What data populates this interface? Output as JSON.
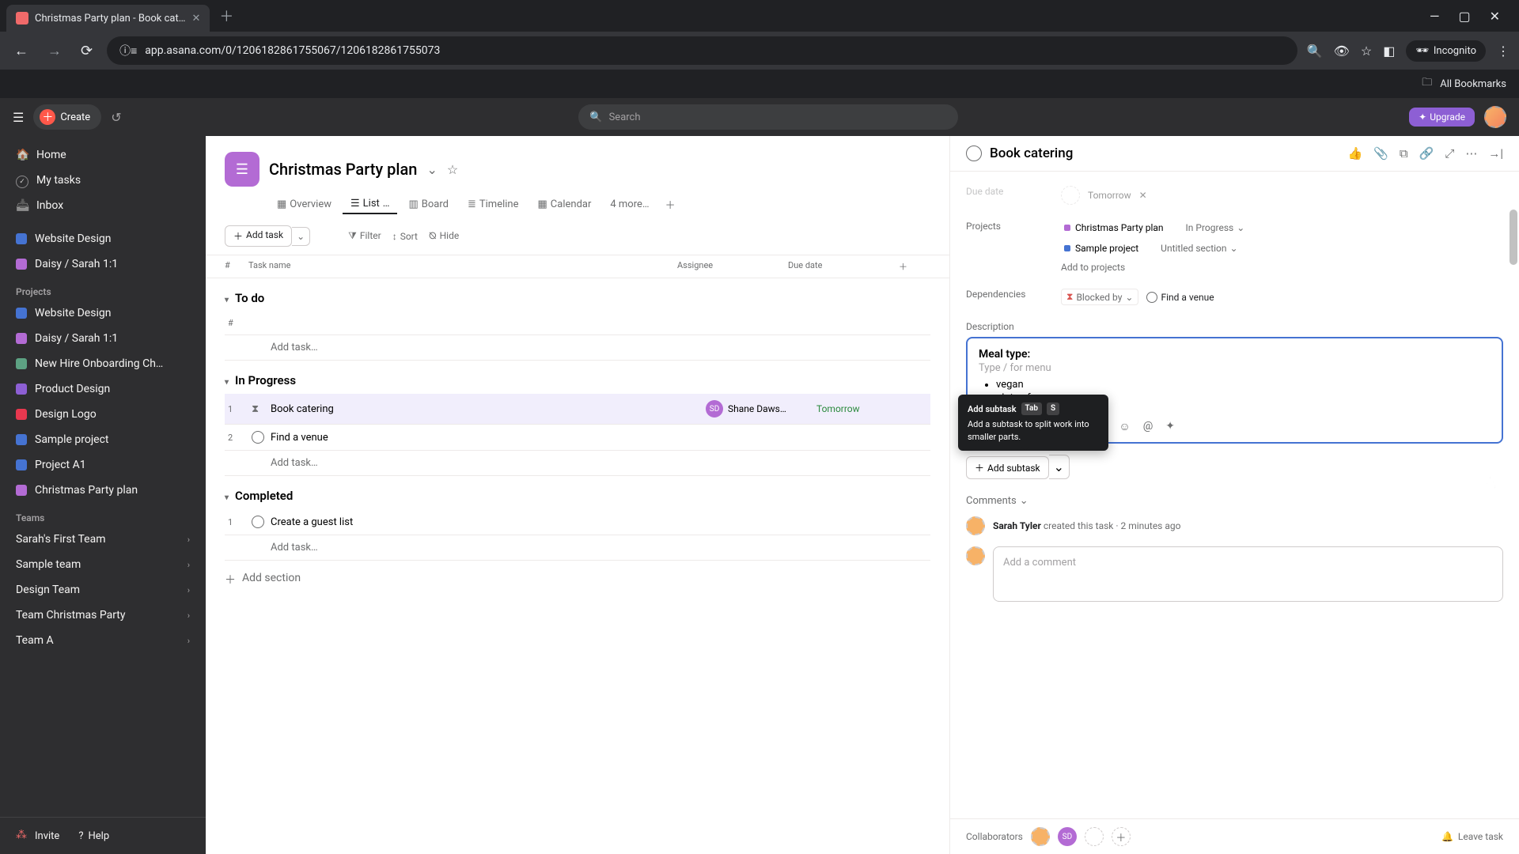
{
  "browser": {
    "tab_title": "Christmas Party plan - Book cat…",
    "url": "app.asana.com/0/1206182861755067/1206182861755073",
    "incognito": "Incognito",
    "all_bookmarks": "All Bookmarks"
  },
  "header": {
    "create": "Create",
    "search_placeholder": "Search",
    "upgrade": "Upgrade"
  },
  "sidebar": {
    "home": "Home",
    "my_tasks": "My tasks",
    "inbox": "Inbox",
    "starred": [
      {
        "label": "Website Design",
        "color": "#4573d2"
      },
      {
        "label": "Daisy / Sarah 1:1",
        "color": "#b36bd4"
      }
    ],
    "projects_header": "Projects",
    "projects": [
      {
        "label": "Website Design",
        "color": "#4573d2"
      },
      {
        "label": "Daisy / Sarah 1:1",
        "color": "#b36bd4"
      },
      {
        "label": "New Hire Onboarding Ch…",
        "color": "#5da283"
      },
      {
        "label": "Product Design",
        "color": "#8d5fd4"
      },
      {
        "label": "Design Logo",
        "color": "#e8384f"
      },
      {
        "label": "Sample project",
        "color": "#4573d2"
      },
      {
        "label": "Project A1",
        "color": "#4573d2"
      },
      {
        "label": "Christmas Party plan",
        "color": "#b36bd4"
      }
    ],
    "teams_header": "Teams",
    "teams": [
      "Sarah's First Team",
      "Sample team",
      "Design Team",
      "Team Christmas Party",
      "Team A"
    ],
    "invite": "Invite",
    "help": "Help"
  },
  "project": {
    "title": "Christmas Party plan",
    "tabs": {
      "overview": "Overview",
      "list": "List",
      "board": "Board",
      "timeline": "Timeline",
      "calendar": "Calendar",
      "more": "4 more…"
    },
    "add_task": "Add task",
    "filter": "Filter",
    "sort": "Sort",
    "hide": "Hide",
    "columns": {
      "num": "#",
      "name": "Task name",
      "assignee": "Assignee",
      "due": "Due date"
    }
  },
  "sections": {
    "todo": {
      "title": "To do",
      "add": "Add task…"
    },
    "in_progress": {
      "title": "In Progress",
      "rows": [
        {
          "num": "1",
          "name": "Book catering",
          "assignee": "Shane Daws…",
          "assignee_initials": "SD",
          "due": "Tomorrow"
        },
        {
          "num": "2",
          "name": "Find a venue",
          "assignee": "",
          "due": ""
        }
      ],
      "add": "Add task…"
    },
    "completed": {
      "title": "Completed",
      "rows": [
        {
          "num": "1",
          "name": "Create a guest list"
        }
      ],
      "add": "Add task…"
    },
    "add_section": "Add section"
  },
  "detail": {
    "title": "Book catering",
    "fields": {
      "due_date_label": "Due date",
      "due_date_value": "Tomorrow",
      "projects_label": "Projects",
      "project1": "Christmas Party plan",
      "project1_status": "In Progress",
      "project2": "Sample project",
      "project2_status": "Untitled section",
      "add_to_projects": "Add to projects",
      "dependencies_label": "Dependencies",
      "blocked_by": "Blocked by",
      "dep_task": "Find a venue",
      "description_label": "Description"
    },
    "description": {
      "title": "Meal type:",
      "placeholder": "Type / for menu",
      "items": [
        "vegan",
        "gluten free"
      ]
    },
    "add_subtask": "Add subtask",
    "tooltip": {
      "title": "Add subtask",
      "key1": "Tab",
      "key2": "S",
      "body": "Add a subtask to split work into smaller parts."
    },
    "comments": {
      "header": "Comments",
      "actor": "Sarah Tyler",
      "action": "created this task",
      "time": "2 minutes ago",
      "placeholder": "Add a comment"
    },
    "footer": {
      "collaborators": "Collaborators",
      "leave": "Leave task"
    }
  }
}
